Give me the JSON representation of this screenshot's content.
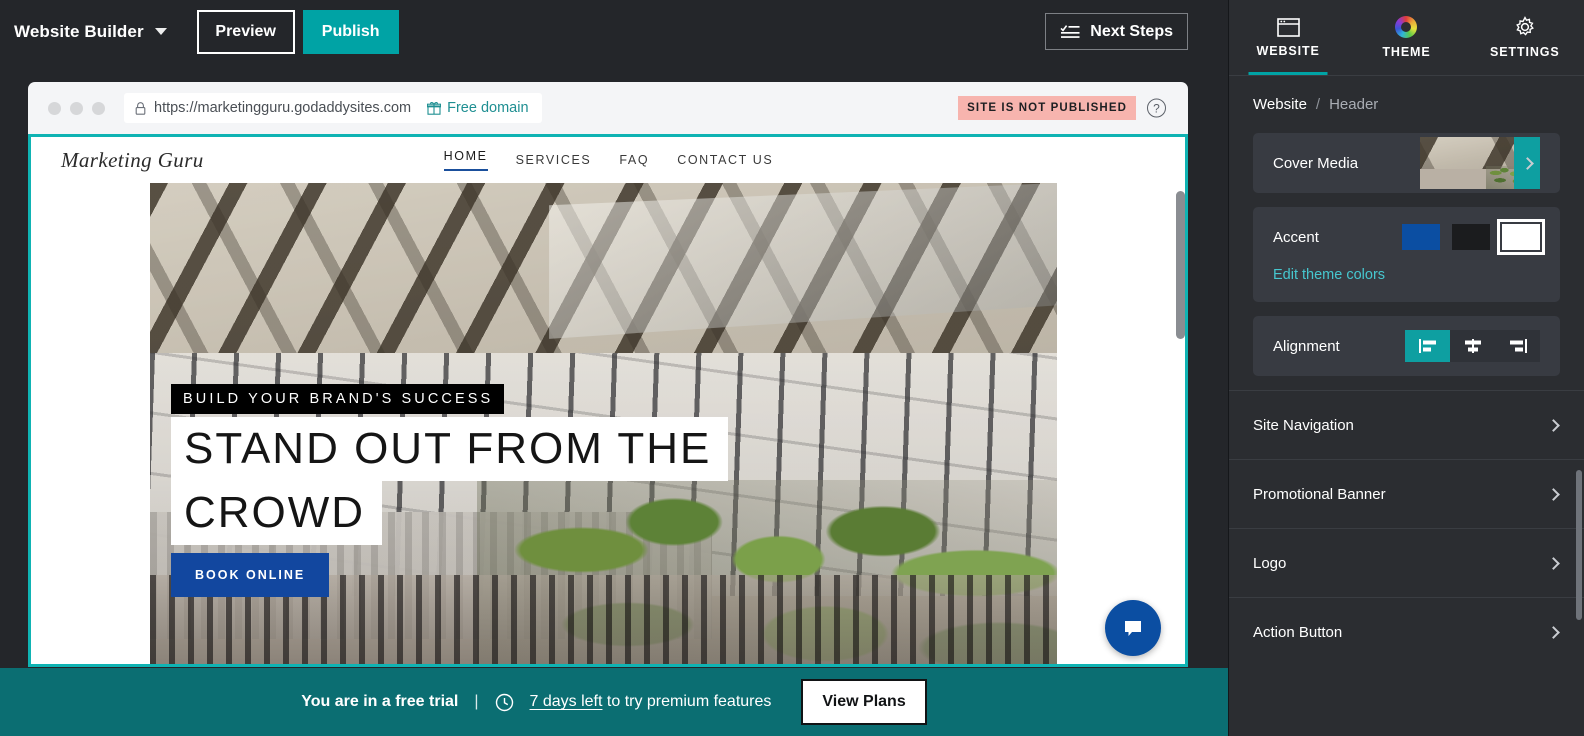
{
  "topbar": {
    "brand": "Website Builder",
    "caret_icon": "chevron-down-icon",
    "preview_label": "Preview",
    "publish_label": "Publish",
    "next_steps_label": "Next Steps",
    "next_steps_icon": "checklist-icon",
    "publish_color": "#00a3a5"
  },
  "browser": {
    "lock_icon": "lock-icon",
    "url": "https://marketingguru.godaddysites.com",
    "free_domain_label": "Free domain",
    "free_domain_icon": "gift-icon",
    "status_badge": "SITE IS NOT PUBLISHED",
    "status_badge_color": "#f7b4ae",
    "help_icon": "?"
  },
  "site": {
    "logo": "Marketing Guru",
    "nav": [
      {
        "label": "HOME",
        "active": true
      },
      {
        "label": "SERVICES",
        "active": false
      },
      {
        "label": "FAQ",
        "active": false
      },
      {
        "label": "CONTACT US",
        "active": false
      }
    ],
    "hero": {
      "eyebrow": "BUILD YOUR BRAND'S SUCCESS",
      "headline_line1": "STAND OUT FROM THE",
      "headline_line2": "CROWD",
      "cta_label": "BOOK ONLINE",
      "cta_color": "#12479f"
    },
    "chat_icon": "chat-bubble-icon"
  },
  "trial": {
    "title": "You are in a free trial",
    "separator": "|",
    "clock_icon": "clock-icon",
    "days_left": "7 days left",
    "suffix": " to try premium features",
    "view_plans_label": "View Plans",
    "bar_color": "#0b6e72"
  },
  "sidebar": {
    "tabs": [
      {
        "label": "WEBSITE",
        "icon": "browser-window-icon",
        "active": true
      },
      {
        "label": "THEME",
        "icon": "color-wheel-icon",
        "active": false
      },
      {
        "label": "SETTINGS",
        "icon": "gear-icon",
        "active": false
      }
    ],
    "breadcrumb": {
      "root": "Website",
      "separator": "/",
      "leaf": "Header"
    },
    "cover_media": {
      "label": "Cover Media",
      "chevron_icon": "chevron-right-icon"
    },
    "accent": {
      "label": "Accent",
      "swatches": [
        {
          "color": "#0b4ea2",
          "selected": false
        },
        {
          "color": "#1b1c1e",
          "selected": false
        },
        {
          "color": "#ffffff",
          "selected": true
        }
      ],
      "edit_link": "Edit theme colors"
    },
    "alignment": {
      "label": "Alignment",
      "options": [
        {
          "icon": "align-left-icon",
          "active": true
        },
        {
          "icon": "align-center-icon",
          "active": false
        },
        {
          "icon": "align-right-icon",
          "active": false
        }
      ]
    },
    "items": [
      {
        "label": "Site Navigation",
        "icon": "chevron-right-icon"
      },
      {
        "label": "Promotional Banner",
        "icon": "chevron-right-icon"
      },
      {
        "label": "Logo",
        "icon": "chevron-right-icon"
      },
      {
        "label": "Action Button",
        "icon": "chevron-right-icon"
      }
    ]
  }
}
